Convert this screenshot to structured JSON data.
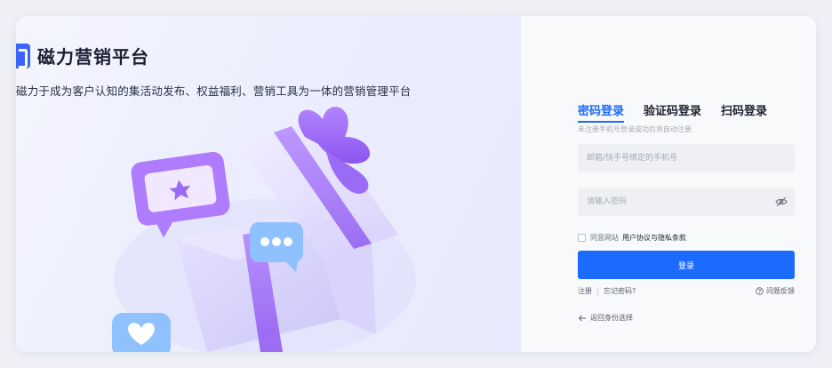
{
  "brand": {
    "name": "磁力营销平台",
    "slogan": "磁力于成为客户认知的集活动发布、权益福利、营销工具为一体的营销管理平台"
  },
  "login": {
    "tabs": [
      "密码登录",
      "验证码登录",
      "扫码登录"
    ],
    "hint": "未注册手机号登录成功后将自动注册",
    "phone_placeholder": "邮箱/快手号绑定的手机号",
    "password_placeholder": "请输入密码",
    "agree_prefix": "同意网站",
    "agree_link": "用户协议与隐私条款",
    "submit": "登录",
    "register": "注册",
    "forgot": "忘记密码?",
    "feedback": "问题反馈",
    "back": "返回身份选择"
  },
  "icons": {
    "eye": "eye-off-icon",
    "feedback": "question-circle-icon",
    "back": "arrow-left-icon",
    "logo": "brand-logo-icon"
  },
  "colors": {
    "primary": "#1b6bff",
    "purple": "#9a6cf5"
  }
}
